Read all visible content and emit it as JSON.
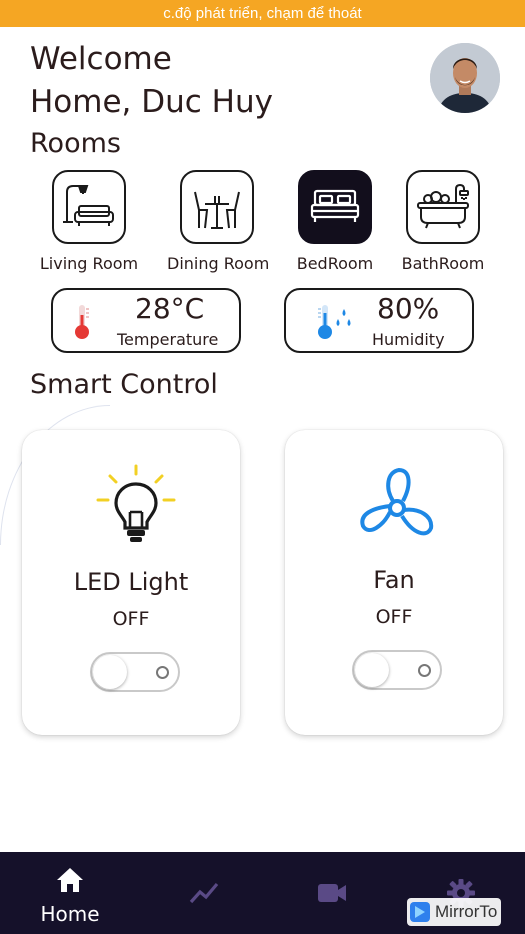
{
  "dev_banner": "c.độ phát triển, chạm để thoát",
  "header": {
    "welcome_line1": "Welcome",
    "welcome_line2": "Home, Duc Huy"
  },
  "rooms": {
    "title": "Rooms",
    "items": [
      {
        "label": "Living Room",
        "icon": "sofa-lamp-icon",
        "active": false
      },
      {
        "label": "Dining Room",
        "icon": "dining-table-icon",
        "active": false
      },
      {
        "label": "BedRoom",
        "icon": "bed-icon",
        "active": true
      },
      {
        "label": "BathRoom",
        "icon": "bathtub-icon",
        "active": false
      }
    ]
  },
  "sensors": {
    "temperature": {
      "value": "28°C",
      "label": "Temperature",
      "icon": "thermometer-hot-icon"
    },
    "humidity": {
      "value": "80%",
      "label": "Humidity",
      "icon": "thermometer-humidity-icon"
    }
  },
  "smart_control": {
    "title": "Smart Control",
    "devices": [
      {
        "name": "LED Light",
        "state": "OFF",
        "icon": "light-bulb-icon",
        "on": false
      },
      {
        "name": "Fan",
        "state": "OFF",
        "icon": "fan-icon",
        "on": false
      }
    ]
  },
  "bottom_nav": {
    "items": [
      {
        "label": "Home",
        "icon": "home-icon",
        "active": true
      },
      {
        "icon": "chart-line-icon",
        "active": false
      },
      {
        "icon": "video-camera-icon",
        "active": false
      },
      {
        "icon": "gear-icon",
        "active": false
      }
    ]
  },
  "overlay": {
    "mirror_label": "MirrorTo"
  },
  "colors": {
    "banner": "#f5a623",
    "nav_bg": "#15112a",
    "active_room": "#120e1c",
    "fan_blue": "#1e88e5",
    "bulb_yellow": "#f2d024"
  }
}
